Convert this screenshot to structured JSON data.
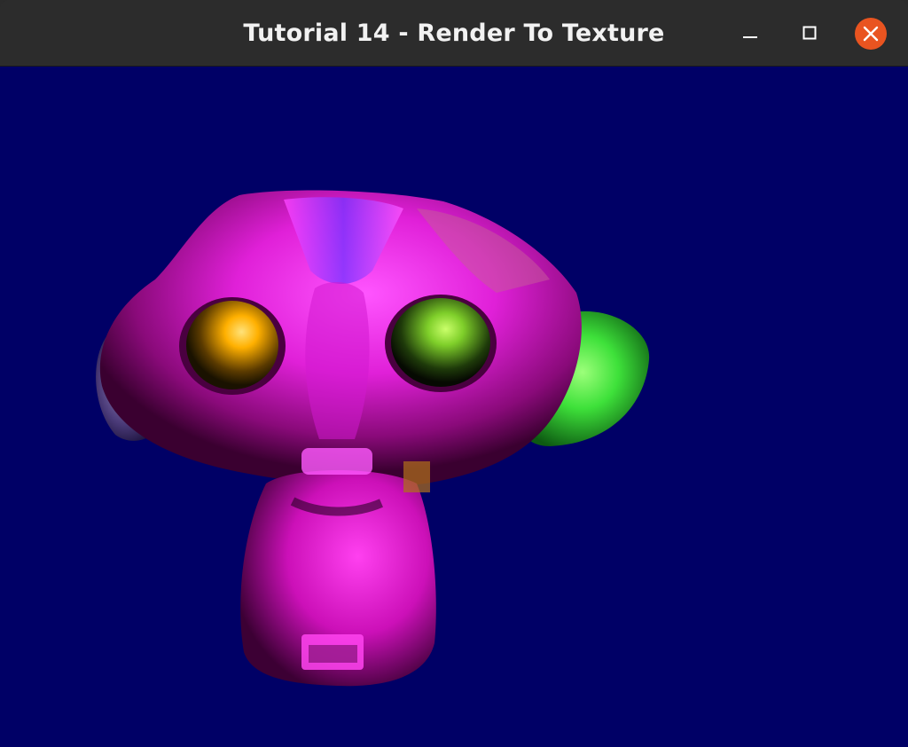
{
  "window": {
    "title": "Tutorial 14 - Render To Texture",
    "controls": {
      "minimize_icon": "minimize-icon",
      "maximize_icon": "maximize-icon",
      "close_icon": "close-icon"
    }
  },
  "scene": {
    "background_color": "#000066",
    "object": "monkey head (Suzanne) rendered with pixelated texture"
  },
  "colors": {
    "close_button": "#e95420",
    "titlebar": "#2c2c2c",
    "title_text": "#f2f2f2"
  }
}
